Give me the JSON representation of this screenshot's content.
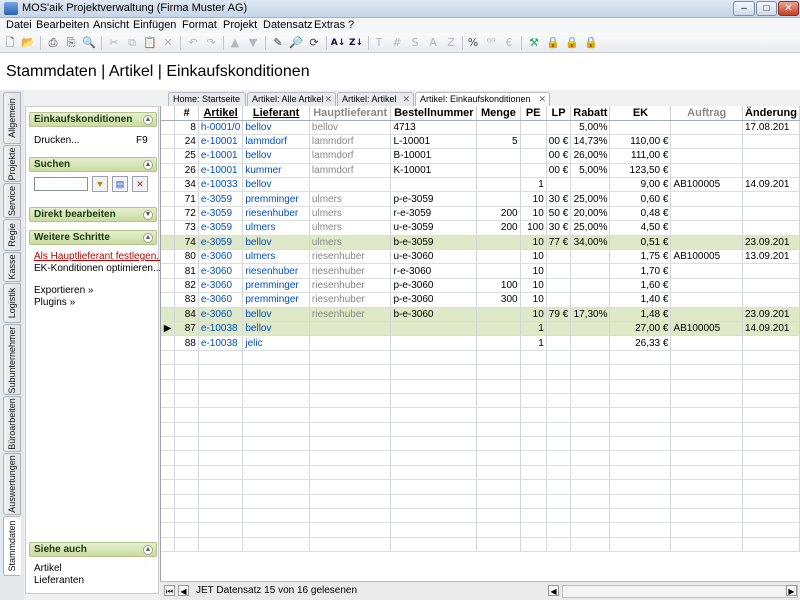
{
  "window": {
    "title": "MOS'aik Projektverwaltung (Firma Muster AG)",
    "min_glyph": "–",
    "max_glyph": "□",
    "close_glyph": "✕"
  },
  "menu": [
    "Datei",
    "Bearbeiten",
    "Ansicht",
    "Einfügen",
    "Format",
    "Projekt",
    "Datensatz",
    "Extras",
    "?"
  ],
  "toolbar_text": {
    "t": "T",
    "hash": "#",
    "s": "S",
    "a": "A",
    "z": "Z",
    "percent": "%"
  },
  "page_title": "Stammdaten | Artikel | Einkaufskonditionen",
  "vertical_tabs": [
    "Allgemein",
    "Projekte",
    "Service",
    "Regie",
    "Kasse",
    "Logistik",
    "Subunternehmer",
    "Büroarbeiten",
    "Auswertungen",
    "Stammdaten"
  ],
  "sidebar": {
    "einkauf": {
      "title": "Einkaufskonditionen",
      "print_label": "Drucken...",
      "print_key": "F9"
    },
    "suchen": {
      "title": "Suchen"
    },
    "direkt": {
      "title": "Direkt bearbeiten"
    },
    "weitere": {
      "title": "Weitere Schritte",
      "items": [
        "Als Hauptlieferant festlegen...",
        "EK-Konditionen optimieren...",
        "Exportieren »",
        "Plugins »"
      ]
    },
    "siehe": {
      "title": "Siehe auch",
      "items": [
        "Artikel",
        "Lieferanten"
      ]
    }
  },
  "doc_tabs": [
    "Home: Startseite",
    "Artikel: Alle Artikel",
    "Artikel: Artikel",
    "Artikel: Einkaufskonditionen"
  ],
  "grid": {
    "columns": [
      "#",
      "Artikel",
      "Lieferant",
      "Hauptlieferant",
      "Bestellnummer",
      "Menge",
      "PE",
      "LP",
      "Rabatt",
      "EK",
      "Auftrag",
      "Änderung"
    ],
    "rows": [
      {
        "n": "8",
        "artikel": "h-0001/0",
        "lieferant": "bellov",
        "haupt": "bellov",
        "best": "4713",
        "menge": "",
        "pe": "",
        "lp": "",
        "rabatt": "5,00%",
        "ek": "",
        "auftrag": "",
        "aend": "17.08.201"
      },
      {
        "n": "24",
        "artikel": "e-10001",
        "lieferant": "lammdorf",
        "haupt": "lammdorf",
        "best": "L-10001",
        "menge": "5",
        "pe": "",
        "lp": "00 €",
        "rabatt": "14,73%",
        "ek": "110,00 €",
        "auftrag": "",
        "aend": ""
      },
      {
        "n": "25",
        "artikel": "e-10001",
        "lieferant": "bellov",
        "haupt": "lammdorf",
        "best": "B-10001",
        "menge": "",
        "pe": "",
        "lp": "00 €",
        "rabatt": "26,00%",
        "ek": "111,00 €",
        "auftrag": "",
        "aend": ""
      },
      {
        "n": "26",
        "artikel": "e-10001",
        "lieferant": "kummer",
        "haupt": "lammdorf",
        "best": "K-10001",
        "menge": "",
        "pe": "",
        "lp": "00 €",
        "rabatt": "5,00%",
        "ek": "123,50 €",
        "auftrag": "",
        "aend": ""
      },
      {
        "n": "34",
        "artikel": "e-10033",
        "lieferant": "bellov",
        "haupt": "",
        "best": "",
        "menge": "",
        "pe": "1",
        "lp": "",
        "rabatt": "",
        "ek": "9,00 €",
        "auftrag": "AB100005",
        "aend": "14.09.201"
      },
      {
        "n": "71",
        "artikel": "e-3059",
        "lieferant": "premminger",
        "haupt": "ulmers",
        "best": "p-e-3059",
        "menge": "",
        "pe": "10",
        "lp": "30 €",
        "rabatt": "25,00%",
        "ek": "0,60 €",
        "auftrag": "",
        "aend": ""
      },
      {
        "n": "72",
        "artikel": "e-3059",
        "lieferant": "riesenhuber",
        "haupt": "ulmers",
        "best": "r-e-3059",
        "menge": "200",
        "pe": "10",
        "lp": "50 €",
        "rabatt": "20,00%",
        "ek": "0,48 €",
        "auftrag": "",
        "aend": ""
      },
      {
        "n": "73",
        "artikel": "e-3059",
        "lieferant": "ulmers",
        "haupt": "ulmers",
        "best": "u-e-3059",
        "menge": "200",
        "pe": "100",
        "lp": "30 €",
        "rabatt": "25,00%",
        "ek": "4,50 €",
        "auftrag": "",
        "aend": ""
      },
      {
        "n": "74",
        "artikel": "e-3059",
        "lieferant": "bellov",
        "haupt": "ulmers",
        "best": "b-e-3059",
        "menge": "",
        "pe": "10",
        "lp": "77 €",
        "rabatt": "34,00%",
        "ek": "0,51 €",
        "auftrag": "",
        "aend": "23.09.201",
        "hl": true
      },
      {
        "n": "80",
        "artikel": "e-3060",
        "lieferant": "ulmers",
        "haupt": "riesenhuber",
        "best": "u-e-3060",
        "menge": "",
        "pe": "10",
        "lp": "",
        "rabatt": "",
        "ek": "1,75 €",
        "auftrag": "AB100005",
        "aend": "13.09.201"
      },
      {
        "n": "81",
        "artikel": "e-3060",
        "lieferant": "riesenhuber",
        "haupt": "riesenhuber",
        "best": "r-e-3060",
        "menge": "",
        "pe": "10",
        "lp": "",
        "rabatt": "",
        "ek": "1,70 €",
        "auftrag": "",
        "aend": ""
      },
      {
        "n": "82",
        "artikel": "e-3060",
        "lieferant": "premminger",
        "haupt": "riesenhuber",
        "best": "p-e-3060",
        "menge": "100",
        "pe": "10",
        "lp": "",
        "rabatt": "",
        "ek": "1,60 €",
        "auftrag": "",
        "aend": ""
      },
      {
        "n": "83",
        "artikel": "e-3060",
        "lieferant": "premminger",
        "haupt": "riesenhuber",
        "best": "p-e-3060",
        "menge": "300",
        "pe": "10",
        "lp": "",
        "rabatt": "",
        "ek": "1,40 €",
        "auftrag": "",
        "aend": ""
      },
      {
        "n": "84",
        "artikel": "e-3060",
        "lieferant": "bellov",
        "haupt": "riesenhuber",
        "best": "b-e-3060",
        "menge": "",
        "pe": "10",
        "lp": "79 €",
        "rabatt": "17,30%",
        "ek": "1,48 €",
        "auftrag": "",
        "aend": "23.09.201",
        "hl": true
      },
      {
        "n": "87",
        "artikel": "e-10038",
        "lieferant": "bellov",
        "haupt": "",
        "best": "",
        "menge": "",
        "pe": "1",
        "lp": "",
        "rabatt": "",
        "ek": "27,00 €",
        "auftrag": "AB100005",
        "aend": "14.09.201",
        "hl": true,
        "cur": true
      },
      {
        "n": "88",
        "artikel": "e-10038",
        "lieferant": "jelic",
        "haupt": "",
        "best": "",
        "menge": "",
        "pe": "1",
        "lp": "",
        "rabatt": "",
        "ek": "26,33 €",
        "auftrag": "",
        "aend": ""
      }
    ]
  },
  "status": {
    "text": "JET Datensatz 15 von 16 gelesenen"
  },
  "colors": {
    "highlight_row": "#dfe9c7",
    "link": "#0050c8",
    "panel_header": "#c9dca0"
  }
}
